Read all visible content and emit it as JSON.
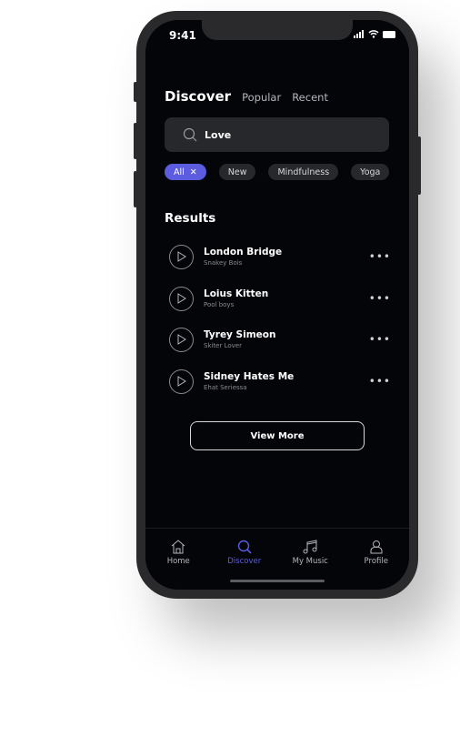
{
  "status": {
    "time": "9:41"
  },
  "header": {
    "tabs": [
      {
        "label": "Discover",
        "active": true
      },
      {
        "label": "Popular"
      },
      {
        "label": "Recent"
      }
    ]
  },
  "search": {
    "value": "Love",
    "icon": "search-icon"
  },
  "chips": [
    {
      "label": "All",
      "active": true
    },
    {
      "label": "New"
    },
    {
      "label": "Mindfulness"
    },
    {
      "label": "Yoga"
    }
  ],
  "results": {
    "heading": "Results",
    "items": [
      {
        "title": "London Bridge",
        "artist": "Snakey Bois"
      },
      {
        "title": "Loius Kitten",
        "artist": "Pool boys"
      },
      {
        "title": "Tyrey Simeon",
        "artist": "Skiter Lover"
      },
      {
        "title": "Sidney Hates Me",
        "artist": "Ehat Seriessa"
      }
    ],
    "more_label": "•••"
  },
  "view_more": "View More",
  "nav": {
    "items": [
      {
        "label": "Home"
      },
      {
        "label": "Discover",
        "active": true
      },
      {
        "label": "My Music"
      },
      {
        "label": "Profile"
      }
    ]
  },
  "colors": {
    "accent": "#5b5ce0",
    "background": "#040509",
    "surface": "#27282c"
  }
}
